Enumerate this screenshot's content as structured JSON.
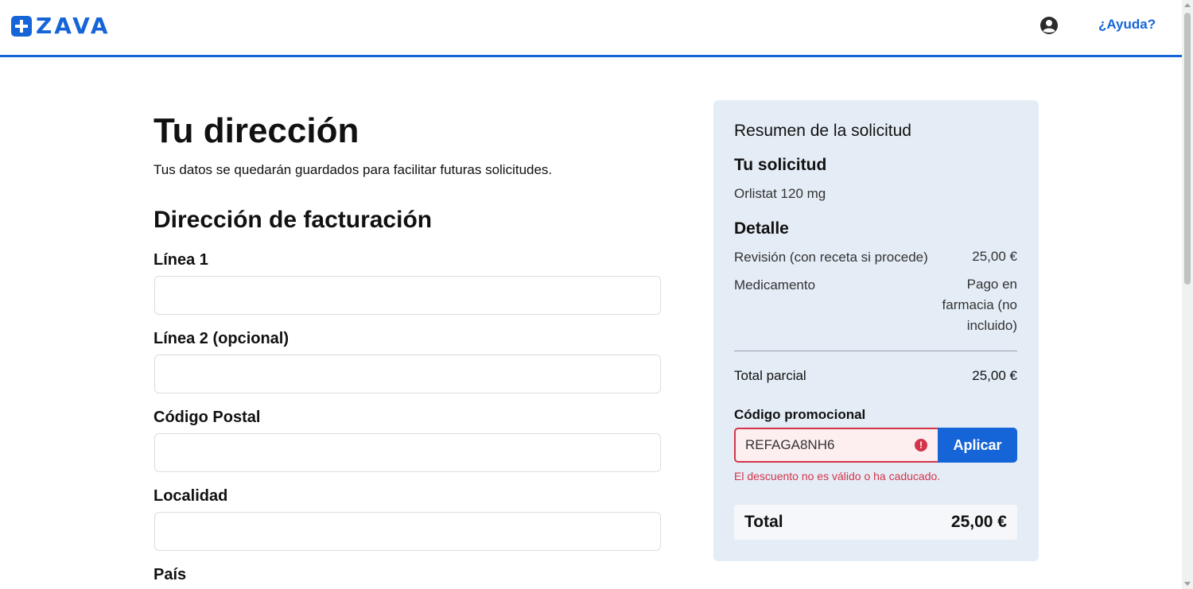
{
  "header": {
    "logo_text": "ZAVA",
    "help_label": "¿Ayuda?",
    "brand_color": "#1565d8"
  },
  "form": {
    "title": "Tu dirección",
    "subtitle": "Tus datos se quedarán guardados para facilitar futuras solicitudes.",
    "section_title": "Dirección de facturación",
    "fields": [
      {
        "label": "Línea 1",
        "value": ""
      },
      {
        "label": "Línea 2 (opcional)",
        "value": ""
      },
      {
        "label": "Código Postal",
        "value": ""
      },
      {
        "label": "Localidad",
        "value": ""
      },
      {
        "label": "País",
        "value": ""
      }
    ]
  },
  "summary": {
    "title": "Resumen de la solicitud",
    "request_heading": "Tu solicitud",
    "request_item": "Orlistat 120 mg",
    "detail_heading": "Detalle",
    "lines": [
      {
        "label": "Revisión (con receta si procede)",
        "value": "25,00 €"
      },
      {
        "label": "Medicamento",
        "value": "Pago en farmacia (no incluido)"
      }
    ],
    "subtotal_label": "Total parcial",
    "subtotal_value": "25,00 €",
    "promo": {
      "label": "Código promocional",
      "value": "REFAGA8NH6",
      "button_label": "Aplicar",
      "error": "El descuento no es válido o ha caducado.",
      "error_color": "#d4344a"
    },
    "total_label": "Total",
    "total_value": "25,00 €"
  }
}
